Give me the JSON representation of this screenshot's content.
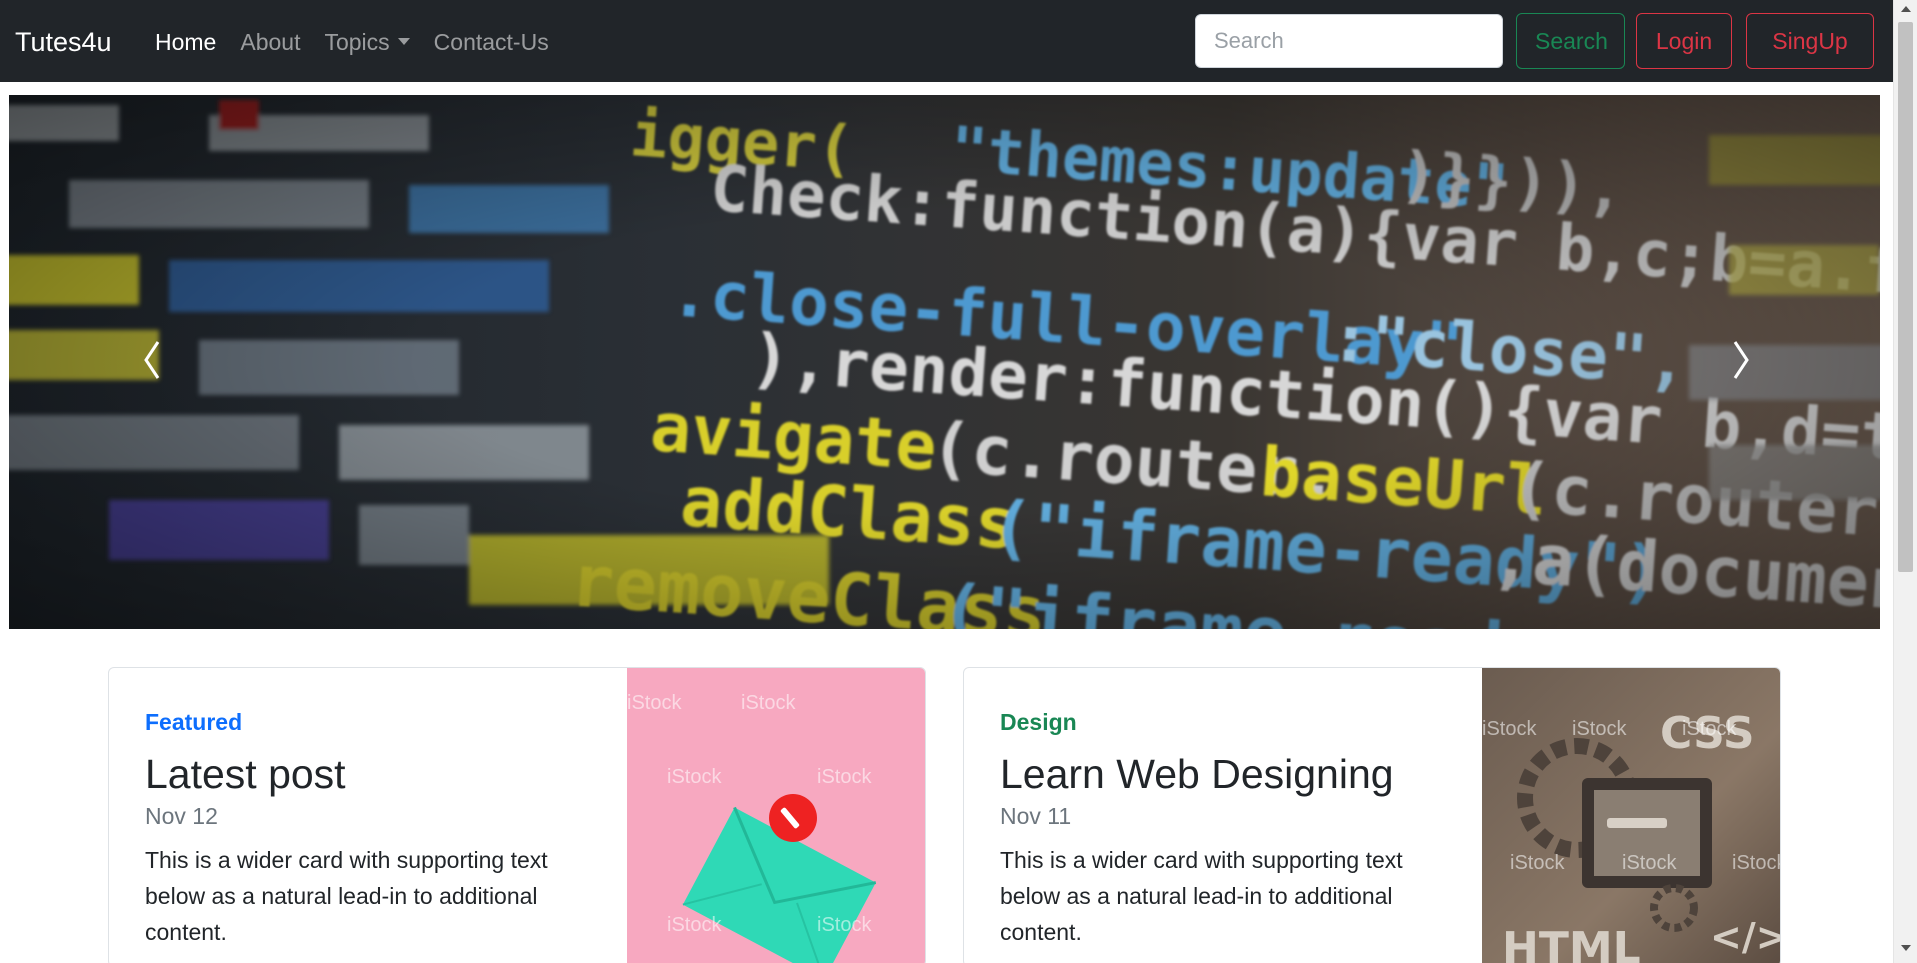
{
  "navbar": {
    "brand": "Tutes4u",
    "links": [
      {
        "label": "Home",
        "active": true
      },
      {
        "label": "About",
        "active": false
      },
      {
        "label": "Topics",
        "active": false,
        "dropdown": true
      },
      {
        "label": "Contact-Us",
        "active": false
      }
    ],
    "search_placeholder": "Search",
    "search_button": "Search",
    "login_button": "Login",
    "signup_button": "SingUp"
  },
  "carousel": {
    "code_lines": [
      "trigger(\"themes:update\")}})),wp.updates",
      "screenshotCheck:function(a){var b,c;b=a.find",
      "\"click .close-full-overlay\":\"close\",\"click",
      "\"theme-preview\"),render:function(){var b,d=this",
      "c.router.navigate(c.router.baseUrl(c.router.them",
      "this.$el.addClass(\"iframe-ready\"),a(document",
      "()).removeClass(\"iframe-ready\")"
    ],
    "prev_icon": "chevron-left-icon",
    "next_icon": "chevron-right-icon"
  },
  "cards": [
    {
      "category": "Featured",
      "title": "Latest post",
      "date": "Nov 12",
      "text": "This is a wider card with supporting text below as a natural lead-in to additional content.",
      "image_watermark": "iStock"
    },
    {
      "category": "Design",
      "title": "Learn Web Designing",
      "date": "Nov 11",
      "text": "This is a wider card with supporting text below as a natural lead-in to additional content.",
      "image_watermark": "iStock",
      "image_texts": [
        "CSS",
        "HTML",
        "</>"
      ]
    }
  ],
  "colors": {
    "navbar_bg": "#212529",
    "primary": "#0d6efd",
    "success": "#198754",
    "danger": "#dc3545"
  }
}
